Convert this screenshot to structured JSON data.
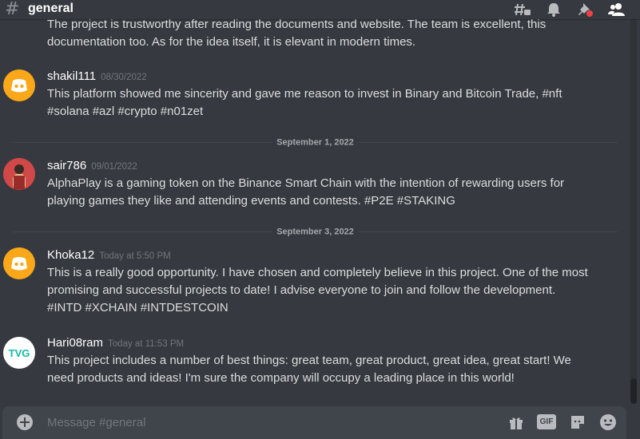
{
  "header": {
    "channel_name": "general"
  },
  "composer": {
    "placeholder": "Message #general",
    "gif_label": "GIF"
  },
  "messages": [
    {
      "lines": [
        "The project is trustworthy after reading the documents and website. The team is excellent, this",
        "documentation too. As for the idea itself, it is elevant in modern times."
      ]
    },
    {
      "username": "shakil111",
      "timestamp": "08/30/2022",
      "lines": [
        "This platform showed me sincerity and gave me reason to invest in Binary and Bitcoin Trade, #nft",
        "#solana #azl #crypto #n01zet"
      ]
    },
    {
      "username": "sair786",
      "timestamp": "09/01/2022",
      "lines": [
        "AlphaPlay is a gaming token on the Binance Smart Chain with the intention of rewarding users for",
        "playing games they like and attending events and contests. #P2E #STAKING"
      ]
    },
    {
      "username": "Khoka12",
      "timestamp": "Today at 5:50 PM",
      "lines": [
        "This is a really good opportunity. I have chosen and completely believe in this project. One of the most",
        "promising and successful projects to date! I advise everyone to join and follow the development.",
        "#INTD #XCHAIN  #INTDESTCOIN"
      ]
    },
    {
      "username": "Hari08ram",
      "timestamp": "Today at 11:53 PM",
      "avatar_text": "TVG",
      "lines": [
        "This project includes a number of best things: great team, great product, great idea, great start! We",
        "need products and ideas! I'm sure the company will occupy a leading place in this world!"
      ]
    }
  ],
  "dividers": [
    "September 1, 2022",
    "September 3, 2022"
  ],
  "colors": {
    "discord_avatar": "#faa81a",
    "background": "#36393f",
    "composer": "#40444b",
    "notification_dot": "#ed4245"
  }
}
